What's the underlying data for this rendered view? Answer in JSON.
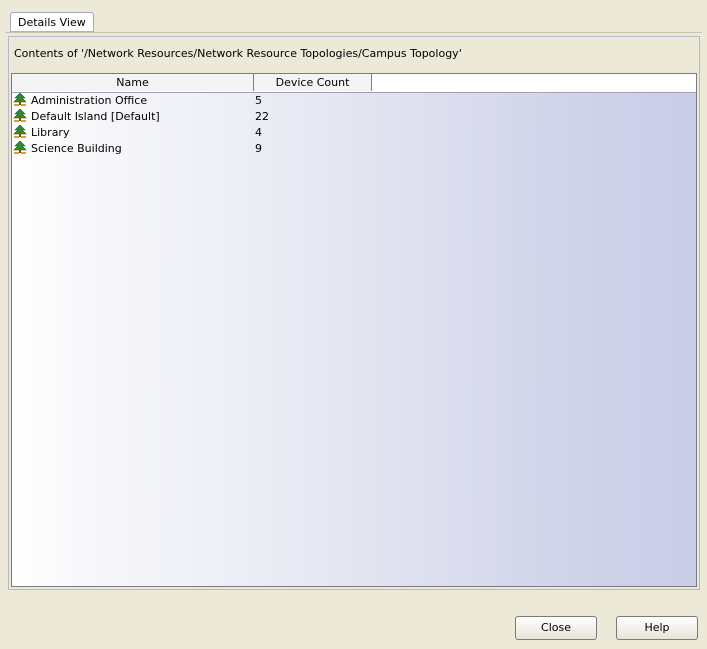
{
  "tabs": [
    {
      "label": "Details View",
      "selected": true
    }
  ],
  "contents_label": "Contents of '/Network Resources/Network Resource Topologies/Campus Topology'",
  "table": {
    "columns": [
      "Name",
      "Device Count"
    ],
    "rows": [
      {
        "name": "Administration Office",
        "device_count": "5",
        "icon": "topology-tree-icon"
      },
      {
        "name": "Default Island [Default]",
        "device_count": "22",
        "icon": "topology-tree-icon"
      },
      {
        "name": "Library",
        "device_count": "4",
        "icon": "topology-tree-icon"
      },
      {
        "name": "Science Building",
        "device_count": "9",
        "icon": "topology-tree-icon"
      }
    ]
  },
  "buttons": {
    "close": "Close",
    "help": "Help"
  }
}
